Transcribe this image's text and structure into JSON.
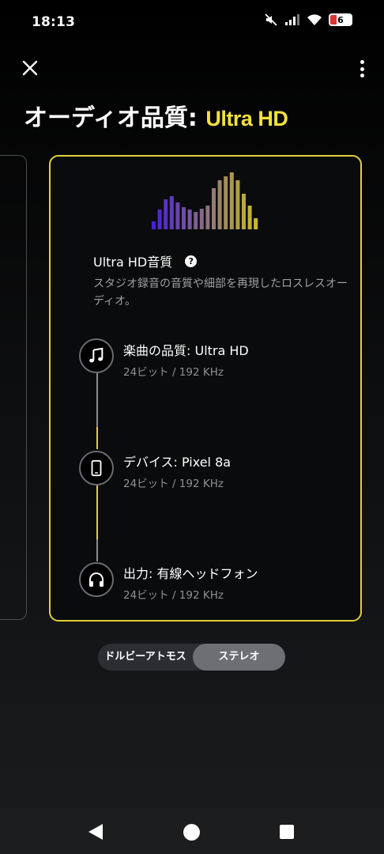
{
  "status_bar": {
    "time": "18:13",
    "battery_level": "6"
  },
  "header": {
    "title": "オーディオ品質:",
    "quality": "Ultra HD"
  },
  "card": {
    "title": "Ultra HD音質",
    "description": "スタジオ録音の音質や細部を再現したロスレスオーディオ。",
    "chain": [
      {
        "icon": "music-note-icon",
        "label": "楽曲の品質: Ultra HD",
        "sub": "24ビット / 192 KHz"
      },
      {
        "icon": "smartphone-icon",
        "label": "デバイス: Pixel 8a",
        "sub": "24ビット / 192 KHz"
      },
      {
        "icon": "headphones-icon",
        "label": "出力: 有線ヘッドフォン",
        "sub": "24ビット / 192 KHz"
      }
    ]
  },
  "toggle": {
    "options": [
      "ドルビーアトモス",
      "ステレオ"
    ],
    "selected": "ステレオ"
  },
  "colors": {
    "accent": "#e2cf3a",
    "title_accent": "#f2e23a",
    "eq_start": "#4a1fd8",
    "eq_end": "#c9bb2a"
  }
}
